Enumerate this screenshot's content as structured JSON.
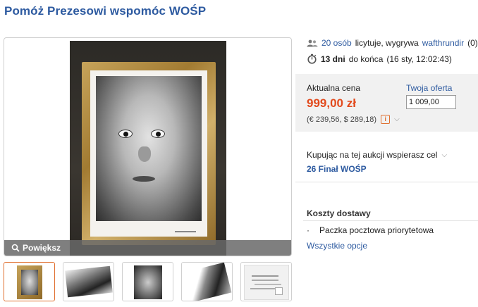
{
  "title": "Pomóż Prezesowi wspomóc WOŚP",
  "bidders": {
    "count_link": "20 osób",
    "text": "licytuje, wygrywa",
    "leader": "wafthrundir",
    "leader_score": "(0)"
  },
  "time": {
    "days": "13 dni",
    "text": "do końca",
    "end": "(16 sty, 12:02:43)"
  },
  "price": {
    "label": "Aktualna cena",
    "value": "999,00 zł",
    "alt": "(€ 239,56, $ 289,18)",
    "info_icon_glyph": "i"
  },
  "offer": {
    "label": "Twoja oferta",
    "value": "1 009,00"
  },
  "charity": {
    "label": "Kupując na tej aukcji wspierasz cel",
    "name": "26 Finał WOŚP"
  },
  "shipping": {
    "title": "Koszty dostawy",
    "bullet": "·",
    "items": [
      "Paczka pocztowa priorytetowa"
    ],
    "all_options": "Wszystkie opcje"
  },
  "gallery": {
    "zoom_label": "Powiększ",
    "thumbnail_count": 5,
    "active_thumbnail": 1
  },
  "colors": {
    "title": "#2d5aa0",
    "link": "#2d5aa0",
    "price": "#e24a1d",
    "active_thumb_border": "#e07030",
    "price_box_bg": "#f1f1f1"
  },
  "icons": {
    "bidders": "users-icon",
    "time": "stopwatch-icon",
    "zoom": "magnifier-icon",
    "info": "info-icon",
    "chevron": "chevron-down-icon"
  }
}
